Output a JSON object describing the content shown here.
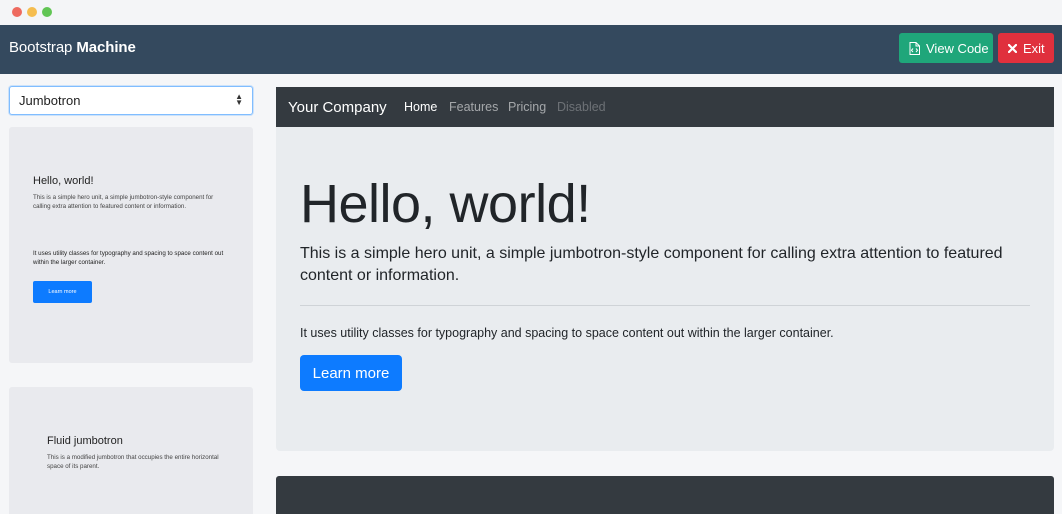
{
  "app": {
    "title_regular": "Bootstrap ",
    "title_bold": "Machine",
    "view_code_label": "View Code",
    "exit_label": "Exit"
  },
  "sidebar": {
    "select_value": "Jumbotron",
    "thumbnails": [
      {
        "title": "Hello, world!",
        "lead": "This is a simple hero unit, a simple jumbotron-style component for calling extra attention to featured content or information.",
        "body": "It uses utility classes for typography and spacing to space content out within the larger container.",
        "button": "Learn more"
      },
      {
        "title": "Fluid jumbotron",
        "lead": "This is a modified jumbotron that occupies the entire horizontal space of its parent."
      }
    ]
  },
  "preview": {
    "navbar": {
      "brand": "Your Company",
      "links": [
        "Home",
        "Features",
        "Pricing",
        "Disabled"
      ]
    },
    "jumbotron": {
      "title": "Hello, world!",
      "lead": "This is a simple hero unit, a simple jumbotron-style component for calling extra attention to featured content or information.",
      "body": "It uses utility classes for typography and spacing to space content out within the larger container.",
      "button": "Learn more"
    }
  },
  "colors": {
    "appbar": "#34495e",
    "view_code": "#1fa67a",
    "exit": "#e0303d",
    "primary": "#0d7bff",
    "navbar_dark": "#343a40",
    "jumbotron_bg": "#e9ecef"
  },
  "icons": [
    "file-code-icon",
    "close-icon",
    "select-caret-icon"
  ]
}
